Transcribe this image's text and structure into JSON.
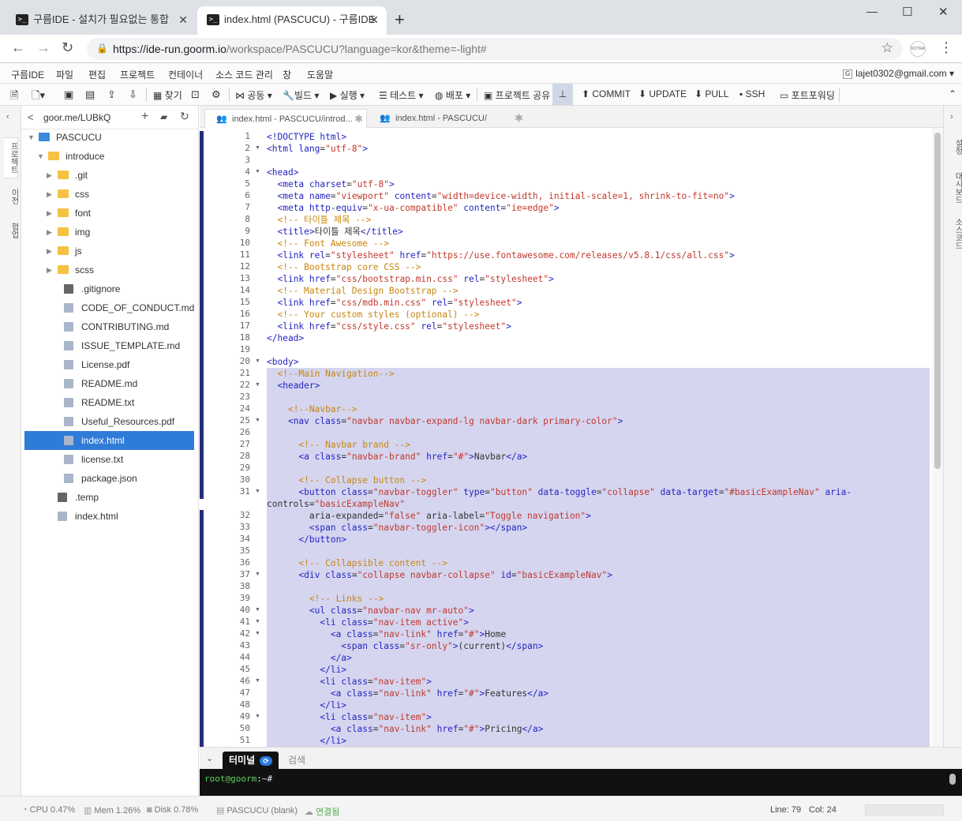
{
  "browser": {
    "tabs": [
      {
        "title": "구름IDE - 설치가 필요없는 통합",
        "active": false
      },
      {
        "title": "index.html (PASCUCU) - 구름IDE",
        "active": true
      }
    ],
    "url_host": "https://ide-run.goorm.io",
    "url_path": "/workspace/PASCUCU?language=kor&theme=-light#"
  },
  "menu": [
    "구름IDE",
    "파일",
    "편집",
    "프로젝트",
    "컨테이너",
    "소스 코드 관리",
    "창",
    "도움말"
  ],
  "account": "lajet0302@gmail.com",
  "toolbar": {
    "find": "찾기",
    "share": "공동",
    "build": "빌드",
    "run": "실행",
    "test": "테스트",
    "deploy": "배포",
    "project_share": "프로젝트 공유",
    "commit": "COMMIT",
    "update": "UPDATE",
    "pull": "PULL",
    "ssh": "SSH",
    "port": "포트포워딩"
  },
  "left_rail": [
    "프로젝트",
    "이전",
    "협업"
  ],
  "right_rail": [
    "설정",
    "대시보드",
    "소스코드"
  ],
  "sidebar": {
    "title": "goor.me/LUBkQ",
    "tree": [
      {
        "label": "PASCUCU",
        "kind": "root"
      },
      {
        "label": "introduce",
        "kind": "folder-open"
      },
      {
        "label": ".git",
        "kind": "folder"
      },
      {
        "label": "css",
        "kind": "folder"
      },
      {
        "label": "font",
        "kind": "folder"
      },
      {
        "label": "img",
        "kind": "folder"
      },
      {
        "label": "js",
        "kind": "folder"
      },
      {
        "label": "scss",
        "kind": "folder"
      },
      {
        "label": ".gitignore",
        "kind": "file"
      },
      {
        "label": "CODE_OF_CONDUCT.md",
        "kind": "file"
      },
      {
        "label": "CONTRIBUTING.md",
        "kind": "file"
      },
      {
        "label": "ISSUE_TEMPLATE.md",
        "kind": "file"
      },
      {
        "label": "License.pdf",
        "kind": "file"
      },
      {
        "label": "README.md",
        "kind": "file"
      },
      {
        "label": "README.txt",
        "kind": "file"
      },
      {
        "label": "Useful_Resources.pdf",
        "kind": "file"
      },
      {
        "label": "index.html",
        "kind": "file-selected"
      },
      {
        "label": "license.txt",
        "kind": "file"
      },
      {
        "label": "package.json",
        "kind": "file"
      },
      {
        "label": ".temp",
        "kind": "file-root"
      },
      {
        "label": "index.html",
        "kind": "file-root"
      }
    ]
  },
  "editor_tabs": [
    {
      "label": "index.html - PASCUCU/introd...",
      "active": true
    },
    {
      "label": "index.html - PASCUCU/",
      "active": false
    }
  ],
  "code_lines": [
    {
      "n": "1",
      "t": "<!DOCTYPE html>"
    },
    {
      "n": "2",
      "t": "<html lang=\"utf-8\">"
    },
    {
      "n": "3",
      "t": ""
    },
    {
      "n": "4",
      "t": "<head>"
    },
    {
      "n": "5",
      "t": "  <meta charset=\"utf-8\">"
    },
    {
      "n": "6",
      "t": "  <meta name=\"viewport\" content=\"width=device-width, initial-scale=1, shrink-to-fit=no\">"
    },
    {
      "n": "7",
      "t": "  <meta http-equiv=\"x-ua-compatible\" content=\"ie=edge\">"
    },
    {
      "n": "8",
      "t": "  <!-- 타이틀 제목 -->"
    },
    {
      "n": "9",
      "t": "  <title>타이틀 제목</title>"
    },
    {
      "n": "10",
      "t": "  <!-- Font Awesome -->"
    },
    {
      "n": "11",
      "t": "  <link rel=\"stylesheet\" href=\"https://use.fontawesome.com/releases/v5.8.1/css/all.css\">"
    },
    {
      "n": "12",
      "t": "  <!-- Bootstrap core CSS -->"
    },
    {
      "n": "13",
      "t": "  <link href=\"css/bootstrap.min.css\" rel=\"stylesheet\">"
    },
    {
      "n": "14",
      "t": "  <!-- Material Design Bootstrap -->"
    },
    {
      "n": "15",
      "t": "  <link href=\"css/mdb.min.css\" rel=\"stylesheet\">"
    },
    {
      "n": "16",
      "t": "  <!-- Your custom styles (optional) -->"
    },
    {
      "n": "17",
      "t": "  <link href=\"css/style.css\" rel=\"stylesheet\">"
    },
    {
      "n": "18",
      "t": "</head>"
    },
    {
      "n": "19",
      "t": ""
    },
    {
      "n": "20",
      "t": "<body>"
    },
    {
      "n": "21",
      "t": "  <!--Main Navigation-->"
    },
    {
      "n": "22",
      "t": "  <header>"
    },
    {
      "n": "23",
      "t": ""
    },
    {
      "n": "24",
      "t": "    <!--Navbar-->"
    },
    {
      "n": "25",
      "t": "    <nav class=\"navbar navbar-expand-lg navbar-dark primary-color\">"
    },
    {
      "n": "26",
      "t": ""
    },
    {
      "n": "27",
      "t": "      <!-- Navbar brand -->"
    },
    {
      "n": "28",
      "t": "      <a class=\"navbar-brand\" href=\"#\">Navbar</a>"
    },
    {
      "n": "29",
      "t": ""
    },
    {
      "n": "30",
      "t": "      <!-- Collapse button -->"
    },
    {
      "n": "31",
      "t": "      <button class=\"navbar-toggler\" type=\"button\" data-toggle=\"collapse\" data-target=\"#basicExampleNav\" aria-"
    },
    {
      "n": "",
      "t": "controls=\"basicExampleNav\""
    },
    {
      "n": "32",
      "t": "        aria-expanded=\"false\" aria-label=\"Toggle navigation\">"
    },
    {
      "n": "33",
      "t": "        <span class=\"navbar-toggler-icon\"></span>"
    },
    {
      "n": "34",
      "t": "      </button>"
    },
    {
      "n": "35",
      "t": ""
    },
    {
      "n": "36",
      "t": "      <!-- Collapsible content -->"
    },
    {
      "n": "37",
      "t": "      <div class=\"collapse navbar-collapse\" id=\"basicExampleNav\">"
    },
    {
      "n": "38",
      "t": ""
    },
    {
      "n": "39",
      "t": "        <!-- Links -->"
    },
    {
      "n": "40",
      "t": "        <ul class=\"navbar-nav mr-auto\">"
    },
    {
      "n": "41",
      "t": "          <li class=\"nav-item active\">"
    },
    {
      "n": "42",
      "t": "            <a class=\"nav-link\" href=\"#\">Home"
    },
    {
      "n": "43",
      "t": "              <span class=\"sr-only\">(current)</span>"
    },
    {
      "n": "44",
      "t": "            </a>"
    },
    {
      "n": "45",
      "t": "          </li>"
    },
    {
      "n": "46",
      "t": "          <li class=\"nav-item\">"
    },
    {
      "n": "47",
      "t": "            <a class=\"nav-link\" href=\"#\">Features</a>"
    },
    {
      "n": "48",
      "t": "          </li>"
    },
    {
      "n": "49",
      "t": "          <li class=\"nav-item\">"
    },
    {
      "n": "50",
      "t": "            <a class=\"nav-link\" href=\"#\">Pricing</a>"
    },
    {
      "n": "51",
      "t": "          </li>"
    }
  ],
  "bottom_tabs": {
    "terminal": "터미널",
    "search": "검색"
  },
  "terminal": {
    "user": "root@goorm",
    "rest": ":~#"
  },
  "status": {
    "cpu": "CPU 0.47%",
    "mem": "Mem 1.26%",
    "disk": "Disk 0.78%",
    "project": "PASCUCU (blank)",
    "connection": "연결됨",
    "line": "Line: 79",
    "col": "Col: 24"
  },
  "colors": {
    "accent": "#2f7bd8",
    "tag": "#2424c2",
    "string": "#c2382b",
    "comment": "#c9860c",
    "selection": "#d5d5f0"
  }
}
